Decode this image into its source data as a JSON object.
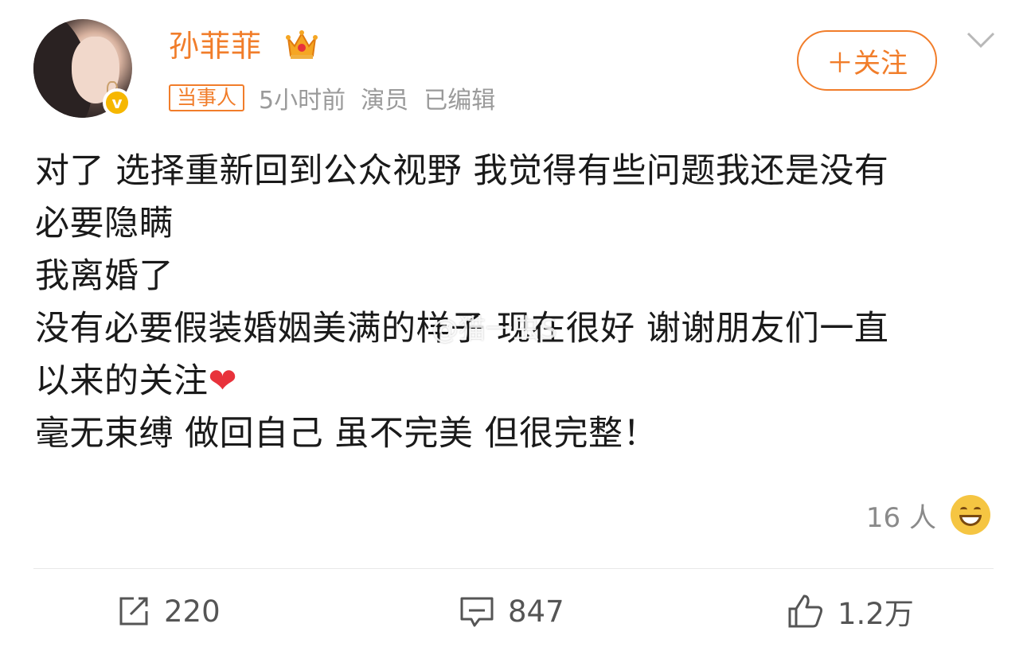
{
  "post": {
    "author": "孙菲菲",
    "party_tag": "当事人",
    "meta": "5小时前  演员  已编辑",
    "follow_label": "＋关注",
    "lines": [
      "对了 选择重新回到公众视野 我觉得有些问题我还是没有",
      "必要隐瞒",
      "我离婚了",
      "没有必要假装婚姻美满的样子 现在很好 谢谢朋友们一直",
      "以来的关注",
      "毫无束缚 做回自己 虽不完美 但很完整！"
    ],
    "heart": "❤",
    "watermark": "@猫一虫S"
  },
  "reactions": {
    "count": "16 人"
  },
  "actions": {
    "share_count": "220",
    "comment_count": "847",
    "like_count": "1.2万"
  },
  "icons": [
    "avatar",
    "verified-icon",
    "crown-icon",
    "chevron-down-icon",
    "share-icon",
    "comment-icon",
    "like-icon",
    "grin-emoji-icon"
  ],
  "colors": {
    "accent": "#f17d2a",
    "badge": "#f6b700",
    "text": "#1a1a1a",
    "muted": "#9a9a9a"
  }
}
